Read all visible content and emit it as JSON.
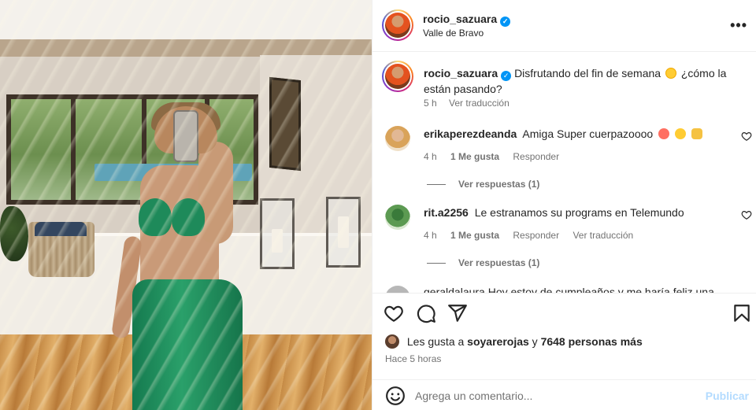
{
  "post": {
    "username": "rocio_sazuara",
    "location": "Valle de Bravo",
    "verified": true
  },
  "caption": {
    "username": "rocio_sazuara",
    "text_before": "Disfrutando del fin de semana",
    "text_after": "¿cómo la están pasando?",
    "time": "5 h",
    "translate": "Ver traducción"
  },
  "comments": [
    {
      "username": "erikaperezdeanda",
      "text": "Amiga Super cuerpazoooo",
      "time": "4 h",
      "likes": "1 Me gusta",
      "reply": "Responder",
      "view_replies": "Ver respuestas (1)",
      "emojis": [
        "kiss-emoji",
        "grin-emoji",
        "victory-hand-emoji"
      ]
    },
    {
      "username": "rit.a2256",
      "text": "Le estranamos su programs en Telemundo",
      "time": "4 h",
      "likes": "1 Me gusta",
      "reply": "Responder",
      "translate": "Ver traducción",
      "view_replies": "Ver respuestas (1)"
    }
  ],
  "peek_comment": {
    "text": "geraldalaura Hoy estoy de cumpleaños y me haría feliz una"
  },
  "actions": {
    "icons": [
      "heart-icon",
      "comment-icon",
      "share-icon",
      "bookmark-icon"
    ]
  },
  "likes": {
    "prefix": "Les gusta a",
    "user": "soyarerojas",
    "connector": "y",
    "others": "7648 personas más"
  },
  "timeago": "Hace 5 horas",
  "add_comment": {
    "placeholder": "Agrega un comentario...",
    "publish": "Publicar"
  },
  "colors": {
    "accent_blue": "#0095f6",
    "publish_disabled": "#b3dbff",
    "secondary_text": "#737373",
    "primary_text": "#262626"
  }
}
